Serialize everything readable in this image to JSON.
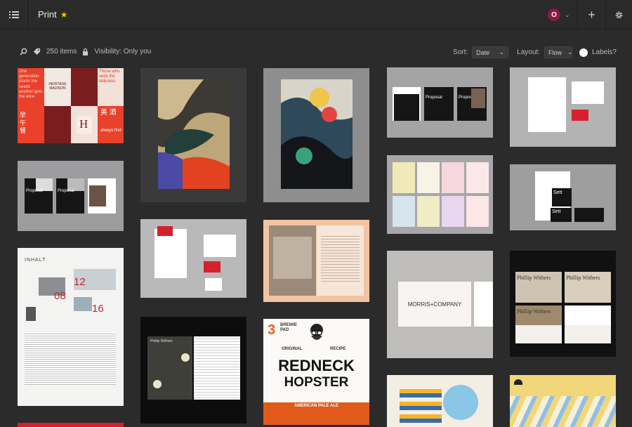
{
  "header": {
    "title": "Print",
    "avatar_letter": "O",
    "add_label": "+",
    "accent_star": "#f2c200",
    "avatar_color": "#8a1846"
  },
  "toolbar": {
    "item_count": "250 items",
    "visibility": "Visibility: Only you",
    "sort_label": "Sort:",
    "sort_value": "Date",
    "layout_label": "Layout:",
    "layout_value": "Flow",
    "labels_label": "Labels?"
  },
  "tiles": {
    "heritage": {
      "t1": "One generation plants the seeds another gets the wine",
      "t2": "HERITAGE MADISON",
      "t3": "Those who seek the delicious",
      "t4": "H",
      "t5": "美 酒",
      "t6": "always find",
      "t7": "早午餐"
    },
    "proposal_left": [
      "Proposal",
      "Proposal"
    ],
    "proposal_right": [
      "Proposal",
      "Proposal"
    ],
    "sett": [
      "Sett",
      "Sett"
    ],
    "inhalt": {
      "title": "INHALT",
      "num1": "12",
      "num2": "08",
      "num3": "16"
    },
    "morris": "MORRIS+COMPANY",
    "phillip": [
      "Phillip Withers",
      "Phillip Withers",
      "Phillip Withers"
    ],
    "phillip_dark": "Phillip Withers",
    "brewie": {
      "num": "3",
      "brand": "BREWIE PAD",
      "left_arc": "ORIGINAL",
      "right_arc": "RECIPE",
      "line1": "REDNECK",
      "line2": "HOPSTER",
      "footer": "AMERICAN PALE ALE"
    }
  }
}
